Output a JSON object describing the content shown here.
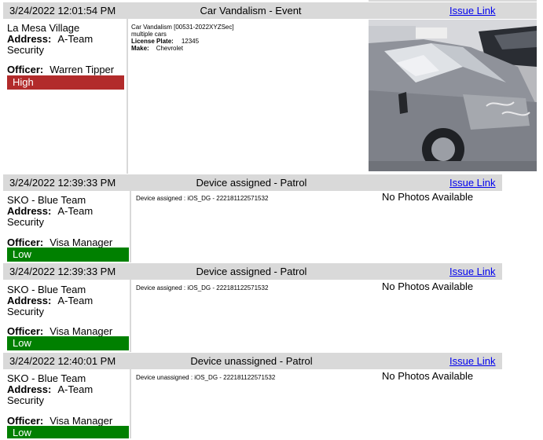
{
  "entries": [
    {
      "timestamp": "3/24/2022 12:01:54 PM",
      "title": "Car Vandalism - Event",
      "issue_link": "Issue Link",
      "site": "La Mesa Village",
      "address_label": "Address:",
      "address_value": "A-Team",
      "address_cont": "Security",
      "officer_label": "Officer:",
      "officer_value": "Warren Tipper",
      "severity": "High",
      "severity_color": "#b22b2b",
      "desc_line1": "Car Vandalism [00531-2022XYZSec]",
      "desc_line2": "multiple cars",
      "plate_label": "License Plate:",
      "plate_value": "12345",
      "make_label": "Make:",
      "make_value": "Chevrolet",
      "photo_icon": "damaged-car-photo"
    },
    {
      "timestamp": "3/24/2022 12:39:33 PM",
      "title": "Device assigned - Patrol",
      "issue_link": "Issue Link",
      "site": "SKO - Blue Team",
      "address_label": "Address:",
      "address_value": "A-Team",
      "address_cont": "Security",
      "officer_label": "Officer:",
      "officer_value": "Visa Manager",
      "severity": "Low",
      "severity_color": "#008000",
      "desc_line1": "Device assigned : iOS_DG - 222181122571532",
      "no_photos": "No Photos Available"
    },
    {
      "timestamp": "3/24/2022 12:39:33 PM",
      "title": "Device assigned - Patrol",
      "issue_link": "Issue Link",
      "site": "SKO - Blue Team",
      "address_label": "Address:",
      "address_value": "A-Team",
      "address_cont": "Security",
      "officer_label": "Officer:",
      "officer_value": "Visa Manager",
      "severity": "Low",
      "severity_color": "#008000",
      "desc_line1": "Device assigned : iOS_DG - 222181122571532",
      "no_photos": "No Photos Available"
    },
    {
      "timestamp": "3/24/2022 12:40:01 PM",
      "title": "Device unassigned - Patrol",
      "issue_link": "Issue Link",
      "site": "SKO - Blue Team",
      "address_label": "Address:",
      "address_value": "A-Team",
      "address_cont": "Security",
      "officer_label": "Officer:",
      "officer_value": "Visa Manager",
      "severity": "Low",
      "severity_color": "#008000",
      "desc_line1": "Device unassigned : iOS_DG - 222181122571532",
      "no_photos": "No Photos Available"
    }
  ]
}
